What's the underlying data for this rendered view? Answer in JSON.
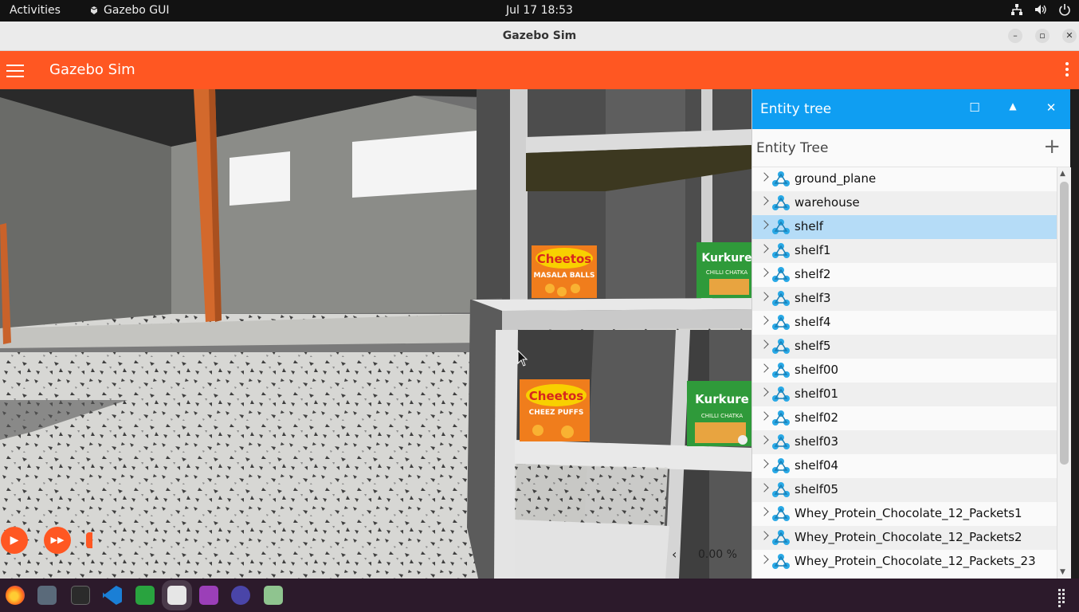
{
  "system_bar": {
    "activities": "Activities",
    "app_name": "Gazebo GUI",
    "clock": "Jul 17  18:53"
  },
  "window": {
    "title": "Gazebo Sim"
  },
  "app_header": {
    "title": "Gazebo Sim"
  },
  "viewport": {
    "real_time_factor": "0.00 %"
  },
  "entity_panel": {
    "header_title": "Entity tree",
    "tree_title": "Entity Tree",
    "selected": "shelf",
    "items": [
      {
        "label": "ground_plane"
      },
      {
        "label": "warehouse"
      },
      {
        "label": "shelf"
      },
      {
        "label": "shelf1"
      },
      {
        "label": "shelf2"
      },
      {
        "label": "shelf3"
      },
      {
        "label": "shelf4"
      },
      {
        "label": "shelf5"
      },
      {
        "label": "shelf00"
      },
      {
        "label": "shelf01"
      },
      {
        "label": "shelf02"
      },
      {
        "label": "shelf03"
      },
      {
        "label": "shelf04"
      },
      {
        "label": "shelf05"
      },
      {
        "label": "Whey_Protein_Chocolate_12_Packets1"
      },
      {
        "label": "Whey_Protein_Chocolate_12_Packets2"
      },
      {
        "label": "Whey_Protein_Chocolate_12_Packets_23"
      }
    ]
  },
  "product_labels": {
    "cheetos_top": "Cheetos",
    "cheetos_top_sub": "MASALA BALLS",
    "cheetos_bottom": "Cheetos",
    "cheetos_bottom_sub": "CHEEZ PUFFS",
    "kurkure": "Kurkure",
    "kurkure_sub": "CHILLI CHATKA"
  },
  "colors": {
    "accent": "#ff5722",
    "panel_header": "#0f9ef2",
    "selection": "#b5dcf7"
  }
}
